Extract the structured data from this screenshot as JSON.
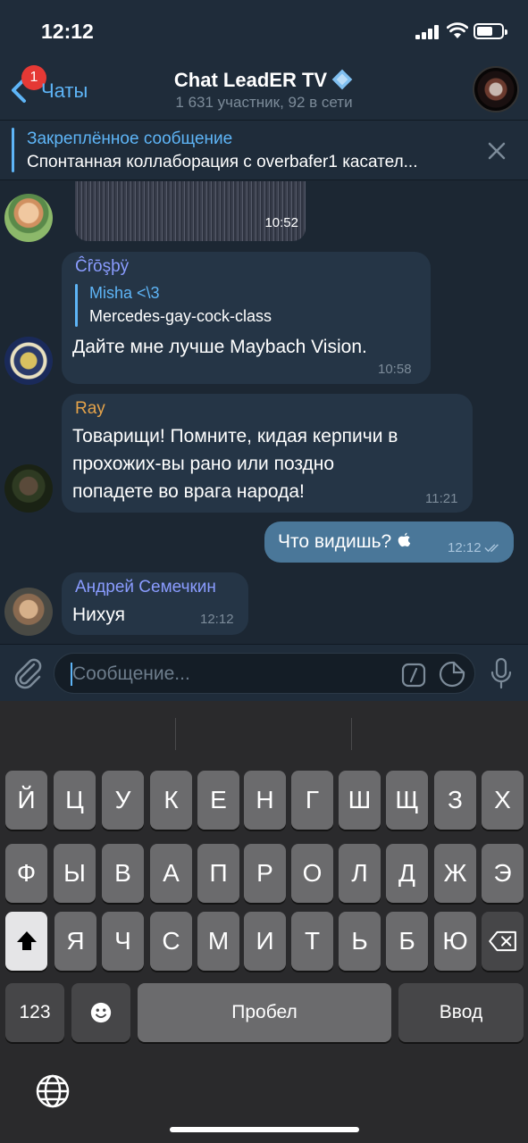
{
  "status_bar": {
    "time": "12:12"
  },
  "header": {
    "back_label": "Чаты",
    "unread_badge": "1",
    "title": "Chat LeadER TV",
    "subtitle": "1 631 участник, 92 в сети"
  },
  "pinned": {
    "title": "Закреплённое сообщение",
    "text": "Спонтанная коллаборация с overbafer1 касател..."
  },
  "messages": [
    {
      "kind": "video",
      "time": "10:52"
    },
    {
      "sender": "Ĉȓōşþÿ",
      "reply_author": "Misha <\\3",
      "reply_text": "Mercedes-gay-cock-class",
      "text": "Дайте мне лучше Maybach Vision.",
      "time": "10:58"
    },
    {
      "sender": "Ray",
      "lines": [
        "Товарищи! Помните, кидая керпичи в",
        "прохожих-вы рано или поздно",
        "попадете во врага народа!"
      ],
      "time": "11:21"
    },
    {
      "outgoing": true,
      "text": "Что видишь? ",
      "time": "12:12"
    },
    {
      "sender": "Андрей Семечкин",
      "text": "Нихуя",
      "time": "12:12"
    }
  ],
  "input": {
    "placeholder": "Сообщение..."
  },
  "keyboard": {
    "row1": [
      "Й",
      "Ц",
      "У",
      "К",
      "Е",
      "Н",
      "Г",
      "Ш",
      "Щ",
      "З",
      "Х"
    ],
    "row2": [
      "Ф",
      "Ы",
      "В",
      "А",
      "П",
      "Р",
      "О",
      "Л",
      "Д",
      "Ж",
      "Э"
    ],
    "row3": [
      "Я",
      "Ч",
      "С",
      "М",
      "И",
      "Т",
      "Ь",
      "Б",
      "Ю"
    ],
    "numbers": "123",
    "space": "Пробел",
    "return": "Ввод"
  },
  "colors": {
    "accent": "#5eb5f7",
    "background": "#1c2733",
    "incoming_bubble": "#253546",
    "outgoing_bubble": "#4a7799",
    "sender_crosby": "#8a9cff",
    "sender_ray": "#e5a34a",
    "sender_andrey": "#8a9cff"
  }
}
